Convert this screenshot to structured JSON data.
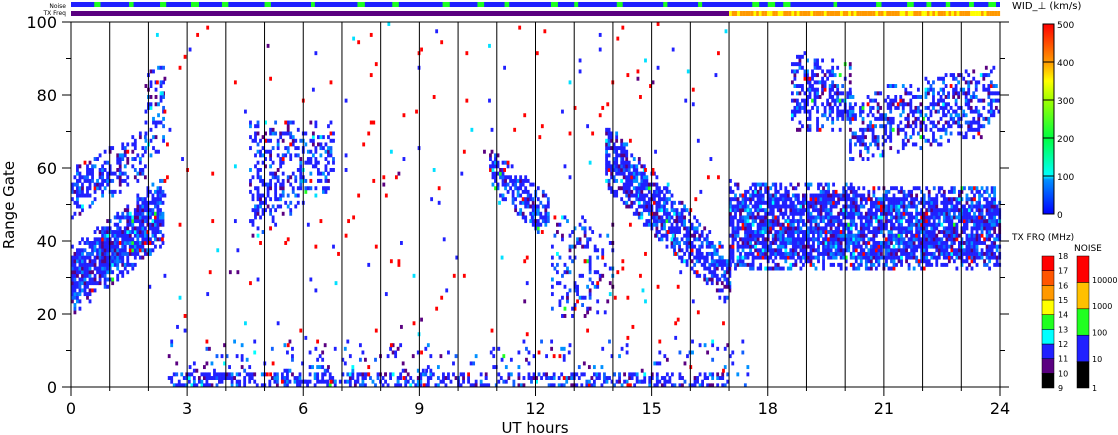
{
  "chart_data": {
    "type": "heatmap",
    "title": "",
    "xlabel": "UT hours",
    "ylabel": "Range Gate",
    "xlim": [
      0,
      24
    ],
    "ylim": [
      0,
      100
    ],
    "xticks": [
      "0",
      "3",
      "6",
      "9",
      "12",
      "15",
      "18",
      "21",
      "24"
    ],
    "yticks": [
      "0",
      "20",
      "40",
      "60",
      "80",
      "100"
    ],
    "grid_x_every_hours": 1,
    "top_bars": {
      "noise_label": "Noise",
      "freq_label": "TX Freq",
      "noise_green_hours": [
        0.6,
        1.5,
        2.3,
        3.1,
        3.9,
        5.0,
        6.2,
        7.4,
        8.3,
        9.6,
        10.5,
        11.2,
        12.4,
        13.0,
        14.1,
        15.3,
        16.2,
        17.6,
        18.0,
        18.4,
        19.7,
        20.8,
        21.6,
        22.1,
        22.6,
        23.2,
        23.7
      ],
      "freq_change_hour": 17.0,
      "freq_before_mhz": 10,
      "freq_after_mhz": [
        15,
        16,
        14
      ]
    },
    "parameter": {
      "label": "WID_⊥ (km/s)",
      "range": [
        0,
        500
      ],
      "ticks": [
        "0",
        "100",
        "200",
        "300",
        "400",
        "500"
      ]
    },
    "tx_freq_scale": {
      "label": "TX FRQ (MHz)",
      "ticks": [
        "9",
        "10",
        "11",
        "12",
        "13",
        "14",
        "15",
        "16",
        "17",
        "18"
      ],
      "colors": [
        "#000000",
        "#5a0080",
        "#2020ff",
        "#00ffff",
        "#20ff20",
        "#ffff00",
        "#ff9900",
        "#ff5500",
        "#ff0000"
      ]
    },
    "noise_scale": {
      "label": "NOISE",
      "ticks": [
        "1",
        "10",
        "100",
        "1000",
        "10000"
      ],
      "colors": [
        "#000000",
        "#2020ff",
        "#20ff20",
        "#ffc000",
        "#ff0000"
      ]
    },
    "echo_regions": [
      {
        "name": "rising-band-main",
        "t": [
          0.0,
          2.4
        ],
        "gates_start": [
          20,
          38
        ],
        "gates_end": [
          40,
          58
        ],
        "density": 0.85
      },
      {
        "name": "rising-band-upper",
        "t": [
          0.0,
          1.9
        ],
        "gates_start": [
          46,
          60
        ],
        "gates_end": [
          58,
          70
        ],
        "density": 0.55
      },
      {
        "name": "upper-patch-early",
        "t": [
          1.9,
          2.4
        ],
        "gates_start": [
          62,
          86
        ],
        "gates_end": [
          66,
          88
        ],
        "density": 0.35
      },
      {
        "name": "patch-5-7h",
        "t": [
          4.6,
          6.8
        ],
        "gates_start": [
          40,
          72
        ],
        "gates_end": [
          56,
          72
        ],
        "density": 0.35
      },
      {
        "name": "band-11-12h",
        "t": [
          10.8,
          12.3
        ],
        "gates_start": [
          55,
          65
        ],
        "gates_end": [
          40,
          52
        ],
        "density": 0.7
      },
      {
        "name": "patch-12-14h",
        "t": [
          12.4,
          14.0
        ],
        "gates_start": [
          18,
          46
        ],
        "gates_end": [
          18,
          46
        ],
        "density": 0.2
      },
      {
        "name": "descending-band",
        "t": [
          13.8,
          17.0
        ],
        "gates_start": [
          55,
          72
        ],
        "gates_end": [
          22,
          36
        ],
        "density": 0.75
      },
      {
        "name": "band-evening",
        "t": [
          17.0,
          24.0
        ],
        "gates_start": [
          32,
          56
        ],
        "gates_end": [
          32,
          54
        ],
        "density": 0.8
      },
      {
        "name": "upper-evening-1",
        "t": [
          18.6,
          20.1
        ],
        "gates_start": [
          70,
          92
        ],
        "gates_end": [
          70,
          88
        ],
        "density": 0.45
      },
      {
        "name": "upper-evening-2",
        "t": [
          20.1,
          24.0
        ],
        "gates_start": [
          62,
          80
        ],
        "gates_end": [
          70,
          88
        ],
        "density": 0.45
      },
      {
        "name": "ground-scatter",
        "t": [
          2.5,
          17.0
        ],
        "gates_start": [
          0,
          3
        ],
        "gates_end": [
          0,
          3
        ],
        "density": 0.75
      },
      {
        "name": "ground-scatter-sparse",
        "t": [
          2.5,
          17.5
        ],
        "gates_start": [
          0,
          12
        ],
        "gates_end": [
          0,
          12
        ],
        "density": 0.08
      },
      {
        "name": "scattered-points",
        "t": [
          2.0,
          17.0
        ],
        "gates_start": [
          0,
          100
        ],
        "gates_end": [
          0,
          100
        ],
        "density": 0.012
      }
    ]
  }
}
